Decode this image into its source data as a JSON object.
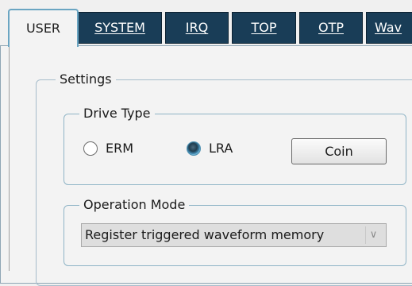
{
  "tabs": [
    {
      "label": "USER",
      "active": true
    },
    {
      "label": "SYSTEM",
      "active": false
    },
    {
      "label": "IRQ",
      "active": false
    },
    {
      "label": "TOP",
      "active": false
    },
    {
      "label": "OTP",
      "active": false
    },
    {
      "label": "Wav",
      "active": false
    }
  ],
  "settings": {
    "legend": "Settings",
    "drive_type": {
      "legend": "Drive Type",
      "options": [
        {
          "label": "ERM",
          "checked": false
        },
        {
          "label": "LRA",
          "checked": true
        }
      ],
      "button_label": "Coin"
    },
    "operation_mode": {
      "legend": "Operation Mode",
      "selected": "Register triggered waveform memory",
      "arrow": "∨"
    }
  },
  "colors": {
    "tab_inactive_bg": "#193d57",
    "tab_active_border": "#6aa5c2",
    "groupbox_border": "#8fb4c6"
  }
}
